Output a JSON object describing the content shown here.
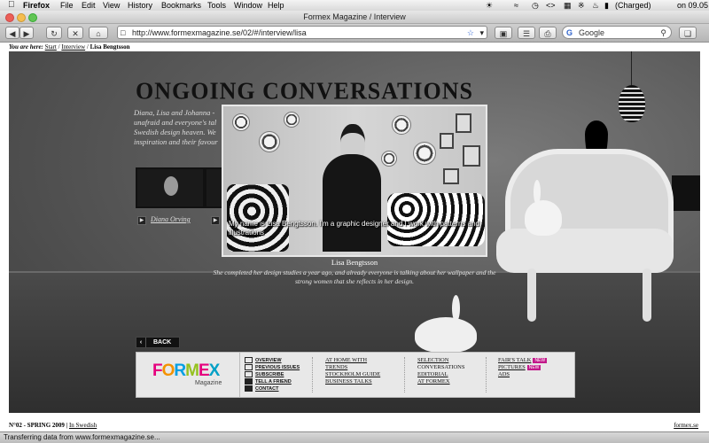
{
  "menubar": {
    "app_name": "Firefox",
    "items": [
      "File",
      "Edit",
      "View",
      "History",
      "Bookmarks",
      "Tools",
      "Window",
      "Help"
    ],
    "battery": "(Charged)",
    "clock": "on 09.05"
  },
  "window": {
    "title": "Formex Magazine / Interview"
  },
  "toolbar": {
    "url": "http://www.formexmagazine.se/02/#/interview/lisa",
    "search_placeholder": "Google"
  },
  "breadcrumb": {
    "label": "You are here:",
    "start": "Start",
    "interview": "Interview",
    "current": "Lisa Bengtsson"
  },
  "article": {
    "headline": "ONGOING CONVERSATIONS",
    "intro": "Diana, Lisa and Johanna - unafraid and everyone's tal Swedish design heaven. We inspiration and their favour",
    "thumb_name": "Diana Orving"
  },
  "video": {
    "subtitle": "My name is Lisa Bengtsson. I'm a graphic designer and I work with patterns and illustrations"
  },
  "caption": {
    "name": "Lisa Bengtsson",
    "description": "She completed her design studies a year ago, and already everyone is talking about her wallpaper and the strong women that she reflects in her design."
  },
  "back_label": "BACK",
  "footer_nav": {
    "logo": "FORMEX",
    "logo_sub": "Magazine",
    "utility": [
      "OVERVIEW",
      "PREVIOUS ISSUES",
      "SUBSCRIBE",
      "TELL A FRIEND",
      "CONTACT"
    ],
    "col2": [
      "AT HOME WITH",
      "TRENDS",
      "STOCKHOLM GUIDE",
      "BUSINESS TALKS"
    ],
    "col3": [
      "SELECTION",
      "CONVERSATIONS",
      "EDITORIAL",
      "AT FORMEX"
    ],
    "col4": [
      {
        "label": "FAIR'S TALK",
        "badge": "NEW"
      },
      {
        "label": "PICTURES",
        "badge": "NEW"
      },
      {
        "label": "ADS",
        "badge": ""
      }
    ]
  },
  "footer": {
    "issue": "N°02 - SPRING 2009",
    "lang_link": "In Swedish",
    "site": "formex.se"
  },
  "status": "Transferring data from www.formexmagazine.se...",
  "colors": {
    "badge": "#c2188a",
    "logo_f": "#e6007e",
    "logo_o": "#f39200",
    "logo_r": "#009fe3",
    "logo_m": "#95c11f",
    "logo_e": "#e6007e",
    "logo_x": "#00a0c6"
  }
}
